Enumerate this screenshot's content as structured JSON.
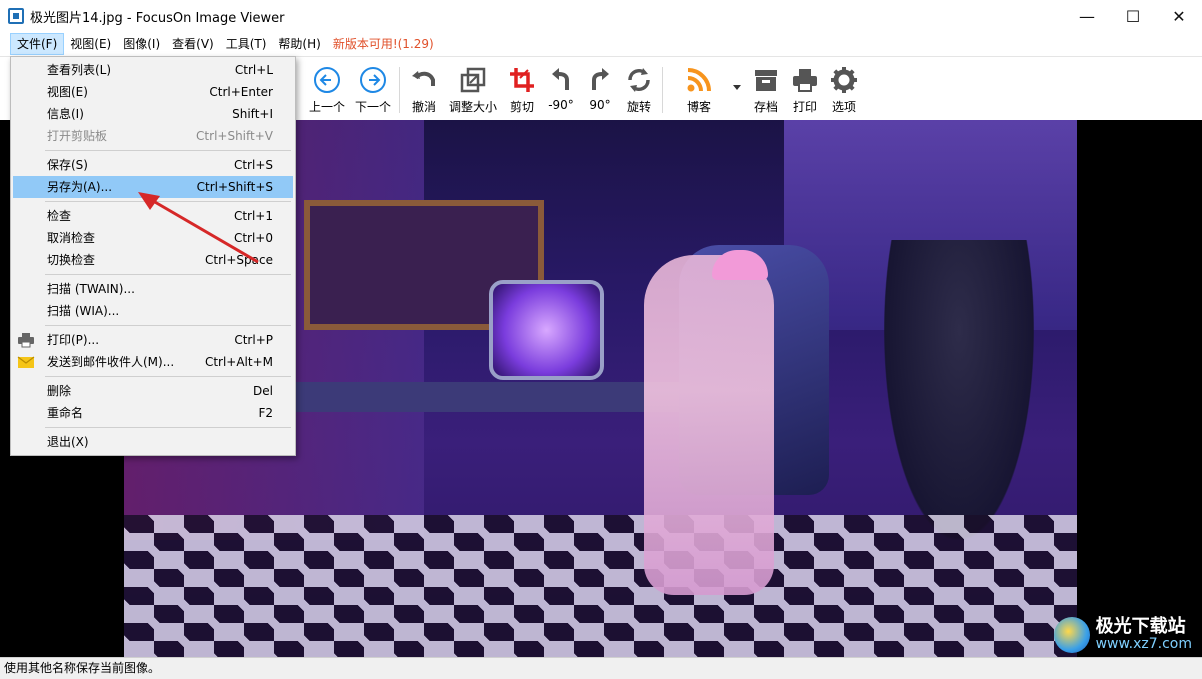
{
  "window": {
    "title": "极光图片14.jpg - FocusOn Image Viewer",
    "minimize": "—",
    "maximize": "☐",
    "close": "✕"
  },
  "menubar": {
    "items": [
      "文件(F)",
      "视图(E)",
      "图像(I)",
      "查看(V)",
      "工具(T)",
      "帮助(H)"
    ],
    "update_notice": "新版本可用!(1.29)"
  },
  "toolbar": {
    "prev": "上一个",
    "next": "下一个",
    "undo": "撤消",
    "resize": "调整大小",
    "crop": "剪切",
    "rotate_left": "-90°",
    "rotate_right": "90°",
    "rotate": "旋转",
    "blog": "博客",
    "save": "存档",
    "print": "打印",
    "options": "选项"
  },
  "file_menu": {
    "items": [
      {
        "label": "查看列表(L)",
        "shortcut": "Ctrl+L"
      },
      {
        "label": "视图(E)",
        "shortcut": "Ctrl+Enter"
      },
      {
        "label": "信息(I)",
        "shortcut": "Shift+I"
      },
      {
        "label": "打开剪贴板",
        "shortcut": "Ctrl+Shift+V"
      },
      {
        "label": "保存(S)",
        "shortcut": "Ctrl+S"
      },
      {
        "label": "另存为(A)...",
        "shortcut": "Ctrl+Shift+S"
      },
      {
        "label": "检查",
        "shortcut": "Ctrl+1"
      },
      {
        "label": "取消检查",
        "shortcut": "Ctrl+0"
      },
      {
        "label": "切换检查",
        "shortcut": "Ctrl+Space"
      },
      {
        "label": "扫描 (TWAIN)...",
        "shortcut": ""
      },
      {
        "label": "扫描 (WIA)...",
        "shortcut": ""
      },
      {
        "label": "打印(P)...",
        "shortcut": "Ctrl+P"
      },
      {
        "label": "发送到邮件收件人(M)...",
        "shortcut": "Ctrl+Alt+M"
      },
      {
        "label": "删除",
        "shortcut": "Del"
      },
      {
        "label": "重命名",
        "shortcut": "F2"
      },
      {
        "label": "退出(X)",
        "shortcut": ""
      }
    ]
  },
  "watermark": {
    "title": "极光下载站",
    "url": "www.xz7.com"
  },
  "statusbar": {
    "text": "使用其他名称保存当前图像。"
  },
  "colors": {
    "highlight": "#91c9f7",
    "update_notice": "#e0502a",
    "nav_icon": "#1e88e5",
    "crop_icon": "#e02020",
    "rss_icon": "#f7941d",
    "arrow_annotation": "#d62828"
  }
}
